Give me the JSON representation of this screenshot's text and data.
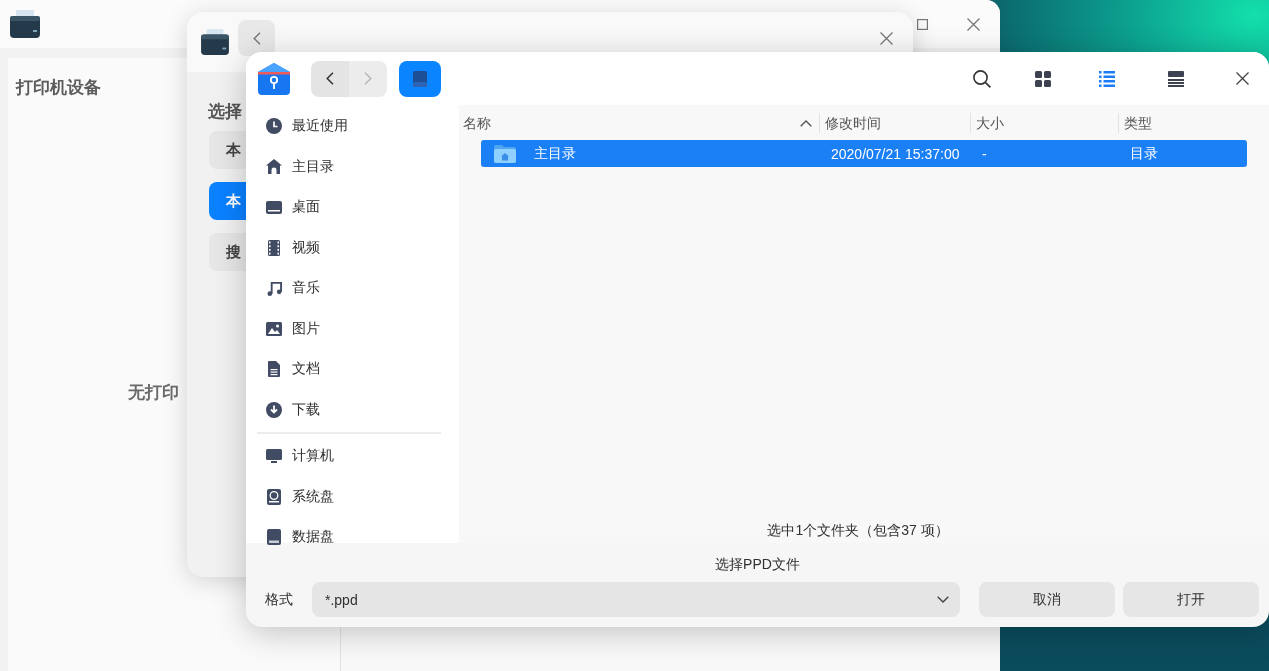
{
  "printer_window": {
    "sidebar_title": "打印机设备",
    "empty_message": "无打印"
  },
  "add_dialog": {
    "heading": "选择",
    "options": [
      {
        "label": "本",
        "selected": false
      },
      {
        "label": "本",
        "selected": true
      },
      {
        "label": "搜",
        "selected": false
      }
    ]
  },
  "file_dialog": {
    "nav_buttons": [
      {
        "kind": "back",
        "disabled": false
      },
      {
        "kind": "forward",
        "disabled": true
      }
    ],
    "view_modes": [
      {
        "kind": "grid",
        "selected": false
      },
      {
        "kind": "list",
        "selected": true
      },
      {
        "kind": "detail",
        "selected": false
      }
    ],
    "sidebar": {
      "groups": [
        {
          "items": [
            {
              "kind": "recent",
              "label": "最近使用"
            },
            {
              "kind": "home",
              "label": "主目录"
            },
            {
              "kind": "desktop",
              "label": "桌面"
            },
            {
              "kind": "videos",
              "label": "视频"
            },
            {
              "kind": "music",
              "label": "音乐"
            },
            {
              "kind": "pictures",
              "label": "图片"
            },
            {
              "kind": "documents",
              "label": "文档"
            },
            {
              "kind": "downloads",
              "label": "下载"
            }
          ]
        },
        {
          "items": [
            {
              "kind": "computer",
              "label": "计算机"
            },
            {
              "kind": "system",
              "label": "系统盘"
            },
            {
              "kind": "data",
              "label": "数据盘"
            }
          ]
        }
      ]
    },
    "columns": [
      {
        "label": "名称",
        "sorted": true
      },
      {
        "label": "修改时间",
        "sorted": false
      },
      {
        "label": "大小",
        "sorted": false
      },
      {
        "label": "类型",
        "sorted": false
      }
    ],
    "rows": [
      {
        "name": "主目录",
        "modified": "2020/07/21 15:37:00",
        "size": "-",
        "type": "目录",
        "selected": true
      }
    ],
    "status": "选中1个文件夹（包含37 项）",
    "caption": "选择PPD文件",
    "format": {
      "label": "格式",
      "value": "*.ppd"
    },
    "buttons": [
      "取消",
      "打开"
    ]
  }
}
